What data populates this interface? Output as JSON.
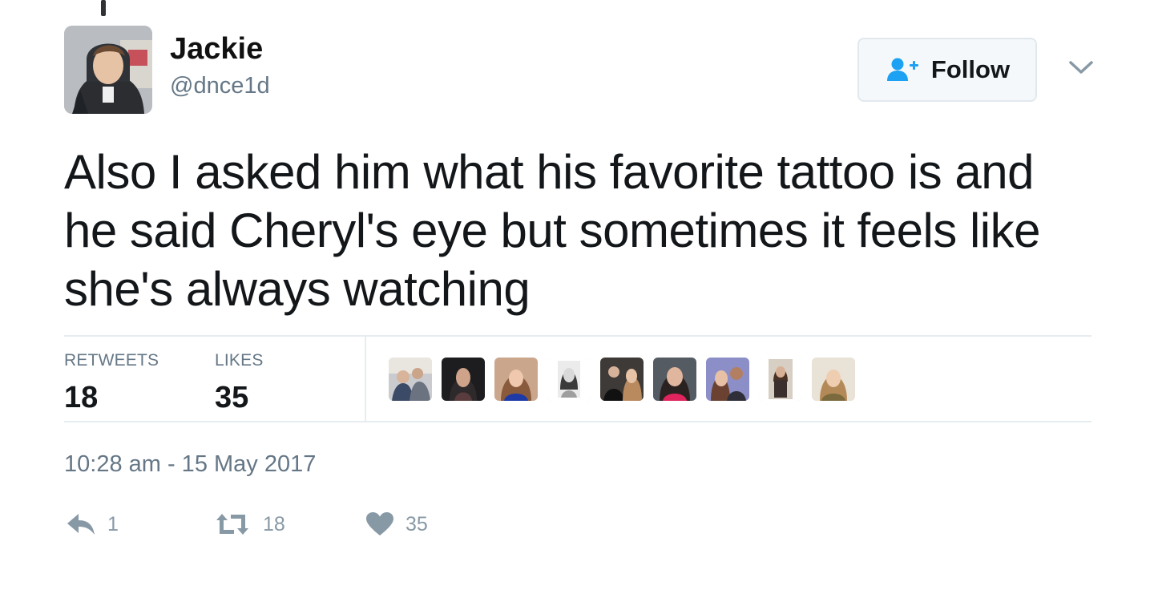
{
  "author": {
    "display_name": "Jackie",
    "handle": "@dnce1d"
  },
  "follow_button": {
    "label": "Follow",
    "icon": "follow-user-plus-icon"
  },
  "menu_icon": "chevron-down-icon",
  "tweet": {
    "text": "Also I asked him what his favorite tattoo is and\nhe said Cheryl's eye but sometimes it feels like\nshe's always watching"
  },
  "stats": {
    "retweets_label": "RETWEETS",
    "retweets_count": "18",
    "likes_label": "LIKES",
    "likes_count": "35"
  },
  "timestamp": "10:28 am - 15 May 2017",
  "actions": {
    "reply_icon": "reply-icon",
    "reply_count": "1",
    "retweet_icon": "retweet-icon",
    "retweet_count": "18",
    "like_icon": "heart-icon",
    "like_count": "35"
  },
  "colors": {
    "text": "#14171a",
    "secondary": "#657786",
    "action_gray": "#8899a6",
    "border": "#e6ecf0",
    "follow_blue": "#1da1f2",
    "follow_bg": "#f5f8fa"
  }
}
